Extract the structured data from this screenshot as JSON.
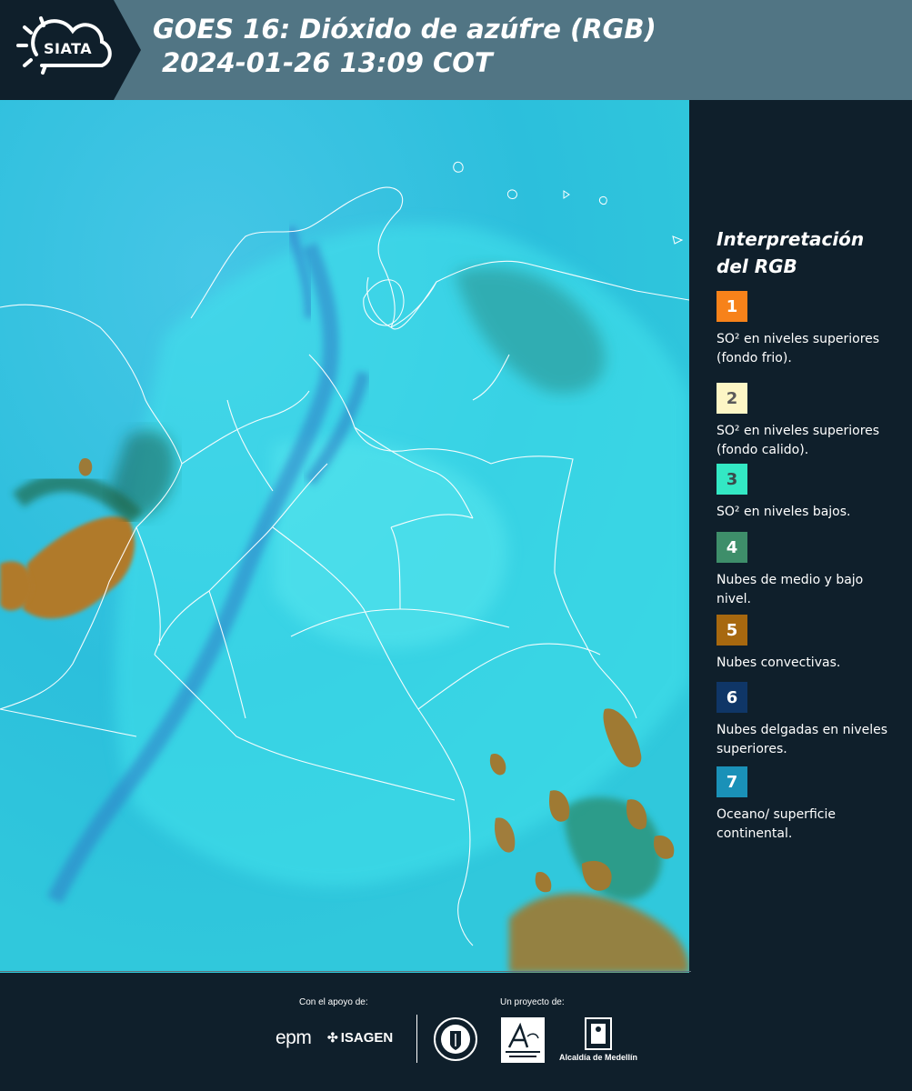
{
  "header": {
    "logo_text": "SIATA",
    "title_line1": "GOES 16: Dióxido de azúfre (RGB)",
    "title_line2": "2024-01-26 13:09 COT"
  },
  "legend": {
    "title": "Interpretación del RGB",
    "items": [
      {
        "number": "1",
        "color": "#f7821a",
        "text_color": "#ffffff",
        "description": "SO² en niveles superiores (fondo frio)."
      },
      {
        "number": "2",
        "color": "#fdf6c5",
        "text_color": "#5a5a5a",
        "description": "SO² en niveles superiores (fondo calido)."
      },
      {
        "number": "3",
        "color": "#33e8c4",
        "text_color": "#3a4a4a",
        "description": "SO² en niveles bajos."
      },
      {
        "number": "4",
        "color": "#3e8e6a",
        "text_color": "#ffffff",
        "description": "Nubes de medio y bajo nivel."
      },
      {
        "number": "5",
        "color": "#a7680f",
        "text_color": "#ffffff",
        "description": "Nubes convectivas."
      },
      {
        "number": "6",
        "color": "#0f3667",
        "text_color": "#ffffff",
        "description": "Nubes delgadas en niveles superiores."
      },
      {
        "number": "7",
        "color": "#1a91b8",
        "text_color": "#ffffff",
        "description": "Oceano/ superficie continental."
      }
    ]
  },
  "footer": {
    "support_label": "Con el apoyo de:",
    "project_label": "Un proyecto de:",
    "sponsor_epm": "epm",
    "sponsor_isagen": "ISAGEN",
    "partner_alcaldia": "Alcaldía de Medellín"
  },
  "colors": {
    "header_bg": "#517584",
    "page_bg": "#0f1f2b",
    "map_base": "#2fc0dc"
  }
}
